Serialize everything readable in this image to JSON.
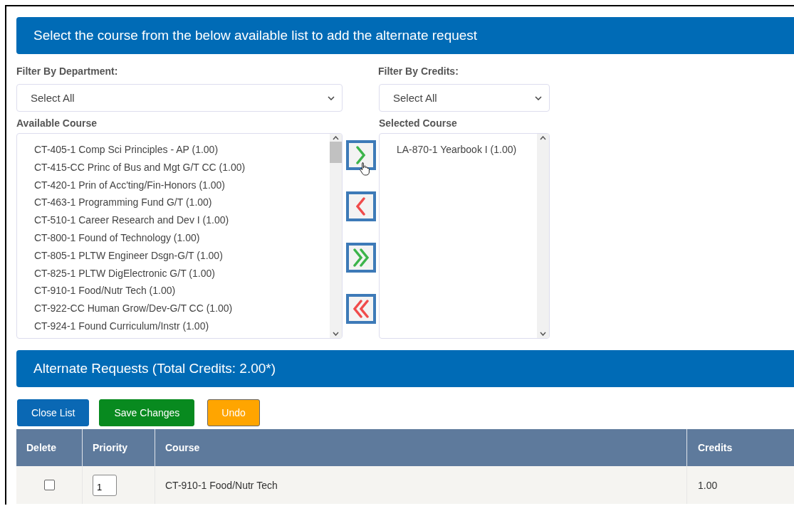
{
  "course_picker": {
    "title": "Select the course from the below available list to add the alternate request",
    "department_filter": {
      "label": "Filter By Department:",
      "value": "Select All"
    },
    "credits_filter": {
      "label": "Filter By Credits:",
      "value": "Select All"
    },
    "available": {
      "label": "Available Course",
      "items": [
        "CT-405-1 Comp Sci Principles - AP (1.00)",
        "CT-415-CC Princ of Bus and Mgt G/T CC (1.00)",
        "CT-420-1 Prin of Acc'ting/Fin-Honors (1.00)",
        "CT-463-1 Programming Fund G/T (1.00)",
        "CT-510-1 Career Research and Dev I (1.00)",
        "CT-800-1 Found of Technology (1.00)",
        "CT-805-1 PLTW Engineer Dsgn-G/T (1.00)",
        "CT-825-1 PLTW DigElectronic G/T (1.00)",
        "CT-910-1 Food/Nutr Tech (1.00)",
        "CT-922-CC Human Grow/Dev-G/T CC (1.00)",
        "CT-924-1 Found Curriculum/Instr (1.00)"
      ]
    },
    "move_buttons": [
      {
        "kind": "add",
        "hovered": true
      },
      {
        "kind": "remove",
        "hovered": false
      },
      {
        "kind": "add-all",
        "hovered": false
      },
      {
        "kind": "remove-all",
        "hovered": false
      }
    ],
    "selected": {
      "label": "Selected Course",
      "items": [
        "LA-870-1 Yearbook I (1.00)"
      ]
    }
  },
  "alternate_requests": {
    "title": "Alternate Requests (Total Credits: 2.00*)",
    "buttons": [
      {
        "kind": "primary",
        "label": "Close List"
      },
      {
        "kind": "success",
        "label": "Save Changes"
      },
      {
        "kind": "warning",
        "label": "Undo"
      }
    ],
    "table": {
      "columns": [
        "Delete",
        "Priority",
        "Course",
        "Credits"
      ],
      "rows": [
        {
          "delete": false,
          "priority": "1",
          "course": "CT-910-1 Food/Nutr Tech",
          "credits": "1.00"
        }
      ]
    }
  }
}
